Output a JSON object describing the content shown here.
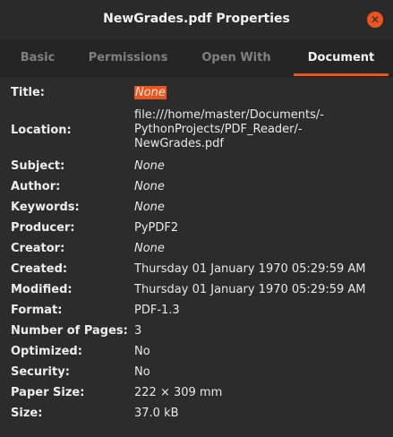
{
  "window": {
    "title": "NewGrades.pdf Properties",
    "close_glyph": "✕"
  },
  "tabs": [
    {
      "label": "Basic",
      "active": false
    },
    {
      "label": "Permissions",
      "active": false
    },
    {
      "label": "Open With",
      "active": false
    },
    {
      "label": "Document",
      "active": true
    }
  ],
  "properties": [
    {
      "label": "Title:",
      "value": "None"
    },
    {
      "label": "Location:",
      "lines": [
        "file:///home/master/Documents/-",
        "PythonProjects/PDF_Reader/-",
        "NewGrades.pdf"
      ]
    },
    {
      "label": "Subject:",
      "value": "None"
    },
    {
      "label": "Author:",
      "value": "None"
    },
    {
      "label": "Keywords:",
      "value": "None"
    },
    {
      "label": "Producer:",
      "value": "PyPDF2"
    },
    {
      "label": "Creator:",
      "value": "None"
    },
    {
      "label": "Created:",
      "value": "Thursday 01 January 1970 05:29:59 AM"
    },
    {
      "label": "Modified:",
      "value": "Thursday 01 January 1970 05:29:59 AM"
    },
    {
      "label": "Format:",
      "value": "PDF-1.3"
    },
    {
      "label": "Number of Pages:",
      "value": "3"
    },
    {
      "label": "Optimized:",
      "value": "No"
    },
    {
      "label": "Security:",
      "value": "No"
    },
    {
      "label": "Paper Size:",
      "value": "222 × 309 mm"
    },
    {
      "label": "Size:",
      "value": "37.0 kB"
    }
  ]
}
